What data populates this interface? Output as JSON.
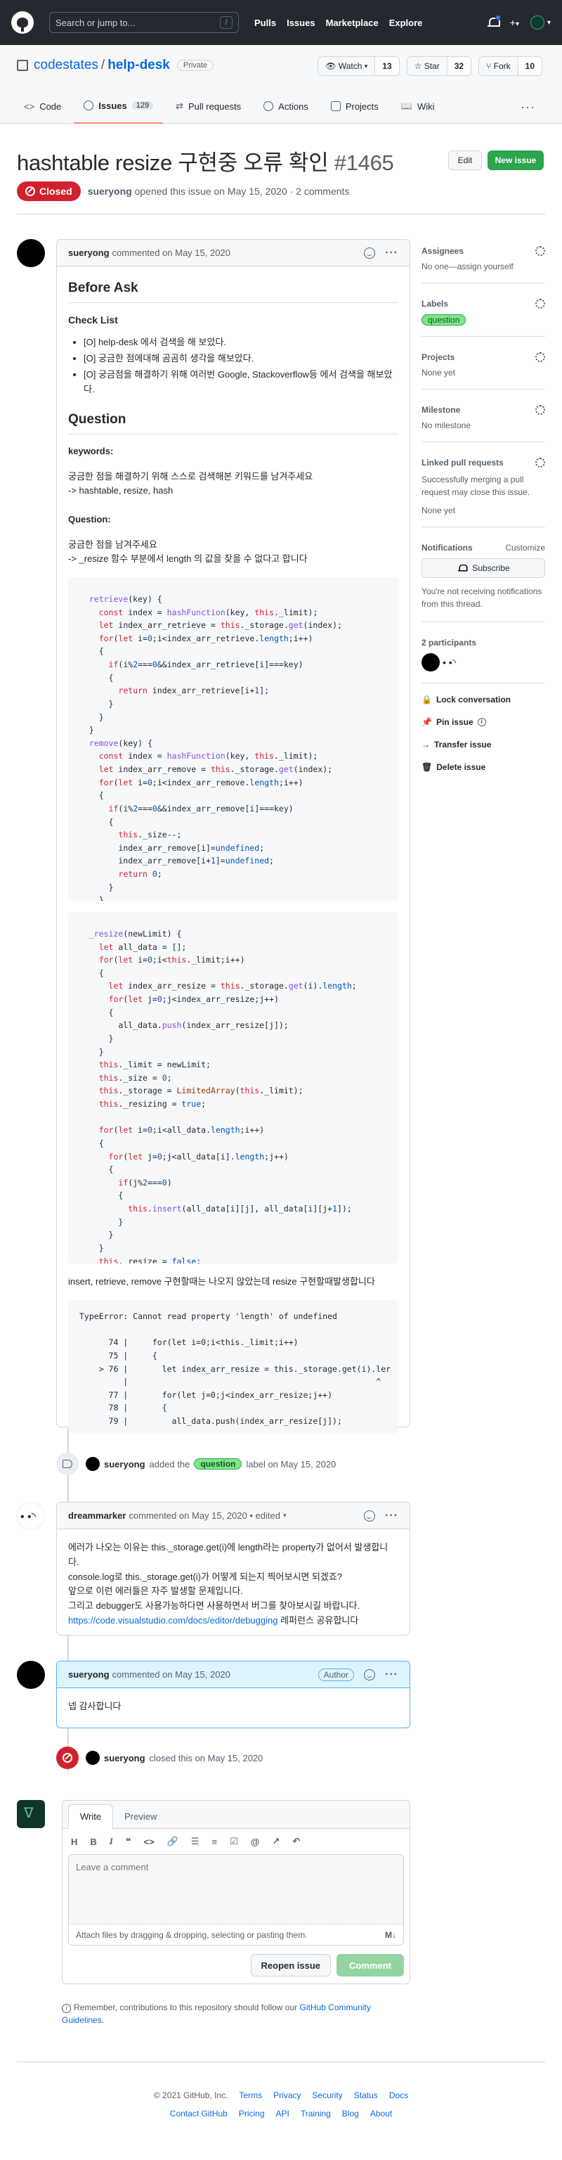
{
  "header": {
    "search_placeholder": "Search or jump to...",
    "search_shortcut": "/",
    "nav": [
      "Pulls",
      "Issues",
      "Marketplace",
      "Explore"
    ],
    "plus": "+",
    "caret": "▾"
  },
  "repo": {
    "owner": "codestates",
    "separator": "/",
    "name": "help-desk",
    "visibility": "Private",
    "watch_label": "Watch",
    "watch_count": "13",
    "star_label": "Star",
    "star_count": "32",
    "fork_label": "Fork",
    "fork_count": "10",
    "tabs": [
      {
        "label": "Code"
      },
      {
        "label": "Issues",
        "count": "129"
      },
      {
        "label": "Pull requests"
      },
      {
        "label": "Actions"
      },
      {
        "label": "Projects"
      },
      {
        "label": "Wiki"
      }
    ],
    "more": "···"
  },
  "issue": {
    "title": "hashtable resize 구현중 오류 확인",
    "number": "#1465",
    "edit_label": "Edit",
    "new_issue_label": "New issue",
    "state": "Closed",
    "author": "sueryong",
    "opened_text": "opened this issue on May 15, 2020 · 2 comments"
  },
  "comment1": {
    "author": "sueryong",
    "meta": "commented on May 15, 2020",
    "h_before_ask": "Before Ask",
    "h_checklist": "Check List",
    "checklist": [
      "[O] help-desk 에서 검색을 해 보았다.",
      "[O] 궁금한 점에대해 곰곰히 생각을 해보았다.",
      "[O] 궁금점을 해결하기 위해 여러번 Google, Stackoverflow등 에서 검색을 해보았다."
    ],
    "h_question": "Question",
    "keywords_label": "keywords:",
    "keywords_line1": "궁금한 점을 해결하기 위해 스스로 검색해본 키워드를 남겨주세요",
    "keywords_line2": "-> hashtable, resize, hash",
    "question_label": "Question:",
    "question_line1": "궁금한 점을 남겨주세요",
    "question_line2": "-> _resize 함수 부분에서 length 의 값을 찾을 수 없다고 합니다",
    "after_code": "insert, retrieve, remove 구현할때는 나오지 않았는데 resize 구현할때발생합니다",
    "error_text": "TypeError: Cannot read property 'length' of undefined\n\n      74 |     for(let i=0;i<this._limit;i++)\n      75 |     {\n    > 76 |       let index_arr_resize = this._storage.get(i).ler\n         |                                                   ^\n      77 |       for(let j=0;j<index_arr_resize;j++)\n      78 |       {\n      79 |         all_data.push(index_arr_resize[j]);"
  },
  "label_event": {
    "author": "sueryong",
    "before": "added the",
    "label": "question",
    "after": "label on May 15, 2020"
  },
  "comment2": {
    "author": "dreammarker",
    "meta": "commented on May 15, 2020 • edited",
    "line1": "에러가 나오는 이유는 this._storage.get(i)에 length라는 property가 없어서 발생합니다.",
    "line2": "console.log로 this._storage.get(i)가 어떻게 되는지 찍어보시면 되겠죠?",
    "line3": "앞으로 이런 에러들은 자주 발생할 문제입니다.",
    "line4": "그리고 debugger도 사용가능하다면 사용하면서 버그를 찾아보시길 바랍니다.",
    "link": "https://code.visualstudio.com/docs/editor/debugging",
    "link_after": " 레퍼런스 공유합니다"
  },
  "comment3": {
    "author": "sueryong",
    "meta": "commented on May 15, 2020",
    "badge": "Author",
    "body": "넵 감사합니다"
  },
  "close_event": {
    "author": "sueryong",
    "text": "closed this on May 15, 2020"
  },
  "sidebar": {
    "assignees_h": "Assignees",
    "assignees_v": "No one—assign yourself",
    "labels_h": "Labels",
    "label": "question",
    "projects_h": "Projects",
    "projects_v": "None yet",
    "milestone_h": "Milestone",
    "milestone_v": "No milestone",
    "linked_h": "Linked pull requests",
    "linked_desc": "Successfully merging a pull request may close this issue.",
    "linked_v": "None yet",
    "notif_h": "Notifications",
    "customize": "Customize",
    "subscribe": "Subscribe",
    "notif_desc": "You're not receiving notifications from this thread.",
    "participants_h": "2 participants",
    "lock": "Lock conversation",
    "pin": "Pin issue",
    "transfer": "Transfer issue",
    "delete": "Delete issue"
  },
  "compose": {
    "tab_write": "Write",
    "tab_preview": "Preview",
    "placeholder": "Leave a comment",
    "attach": "Attach files by dragging & dropping, selecting or pasting them.",
    "reopen": "Reopen issue",
    "comment": "Comment",
    "remember_prefix": "Remember, contributions to this repository should follow our ",
    "remember_link": "GitHub Community Guidelines",
    "remember_suffix": "."
  },
  "footer": {
    "copyright": "© 2021 GitHub, Inc.",
    "row1": [
      "Terms",
      "Privacy",
      "Security",
      "Status",
      "Docs"
    ],
    "row2": [
      "Contact GitHub",
      "Pricing",
      "API",
      "Training",
      "Blog",
      "About"
    ]
  }
}
